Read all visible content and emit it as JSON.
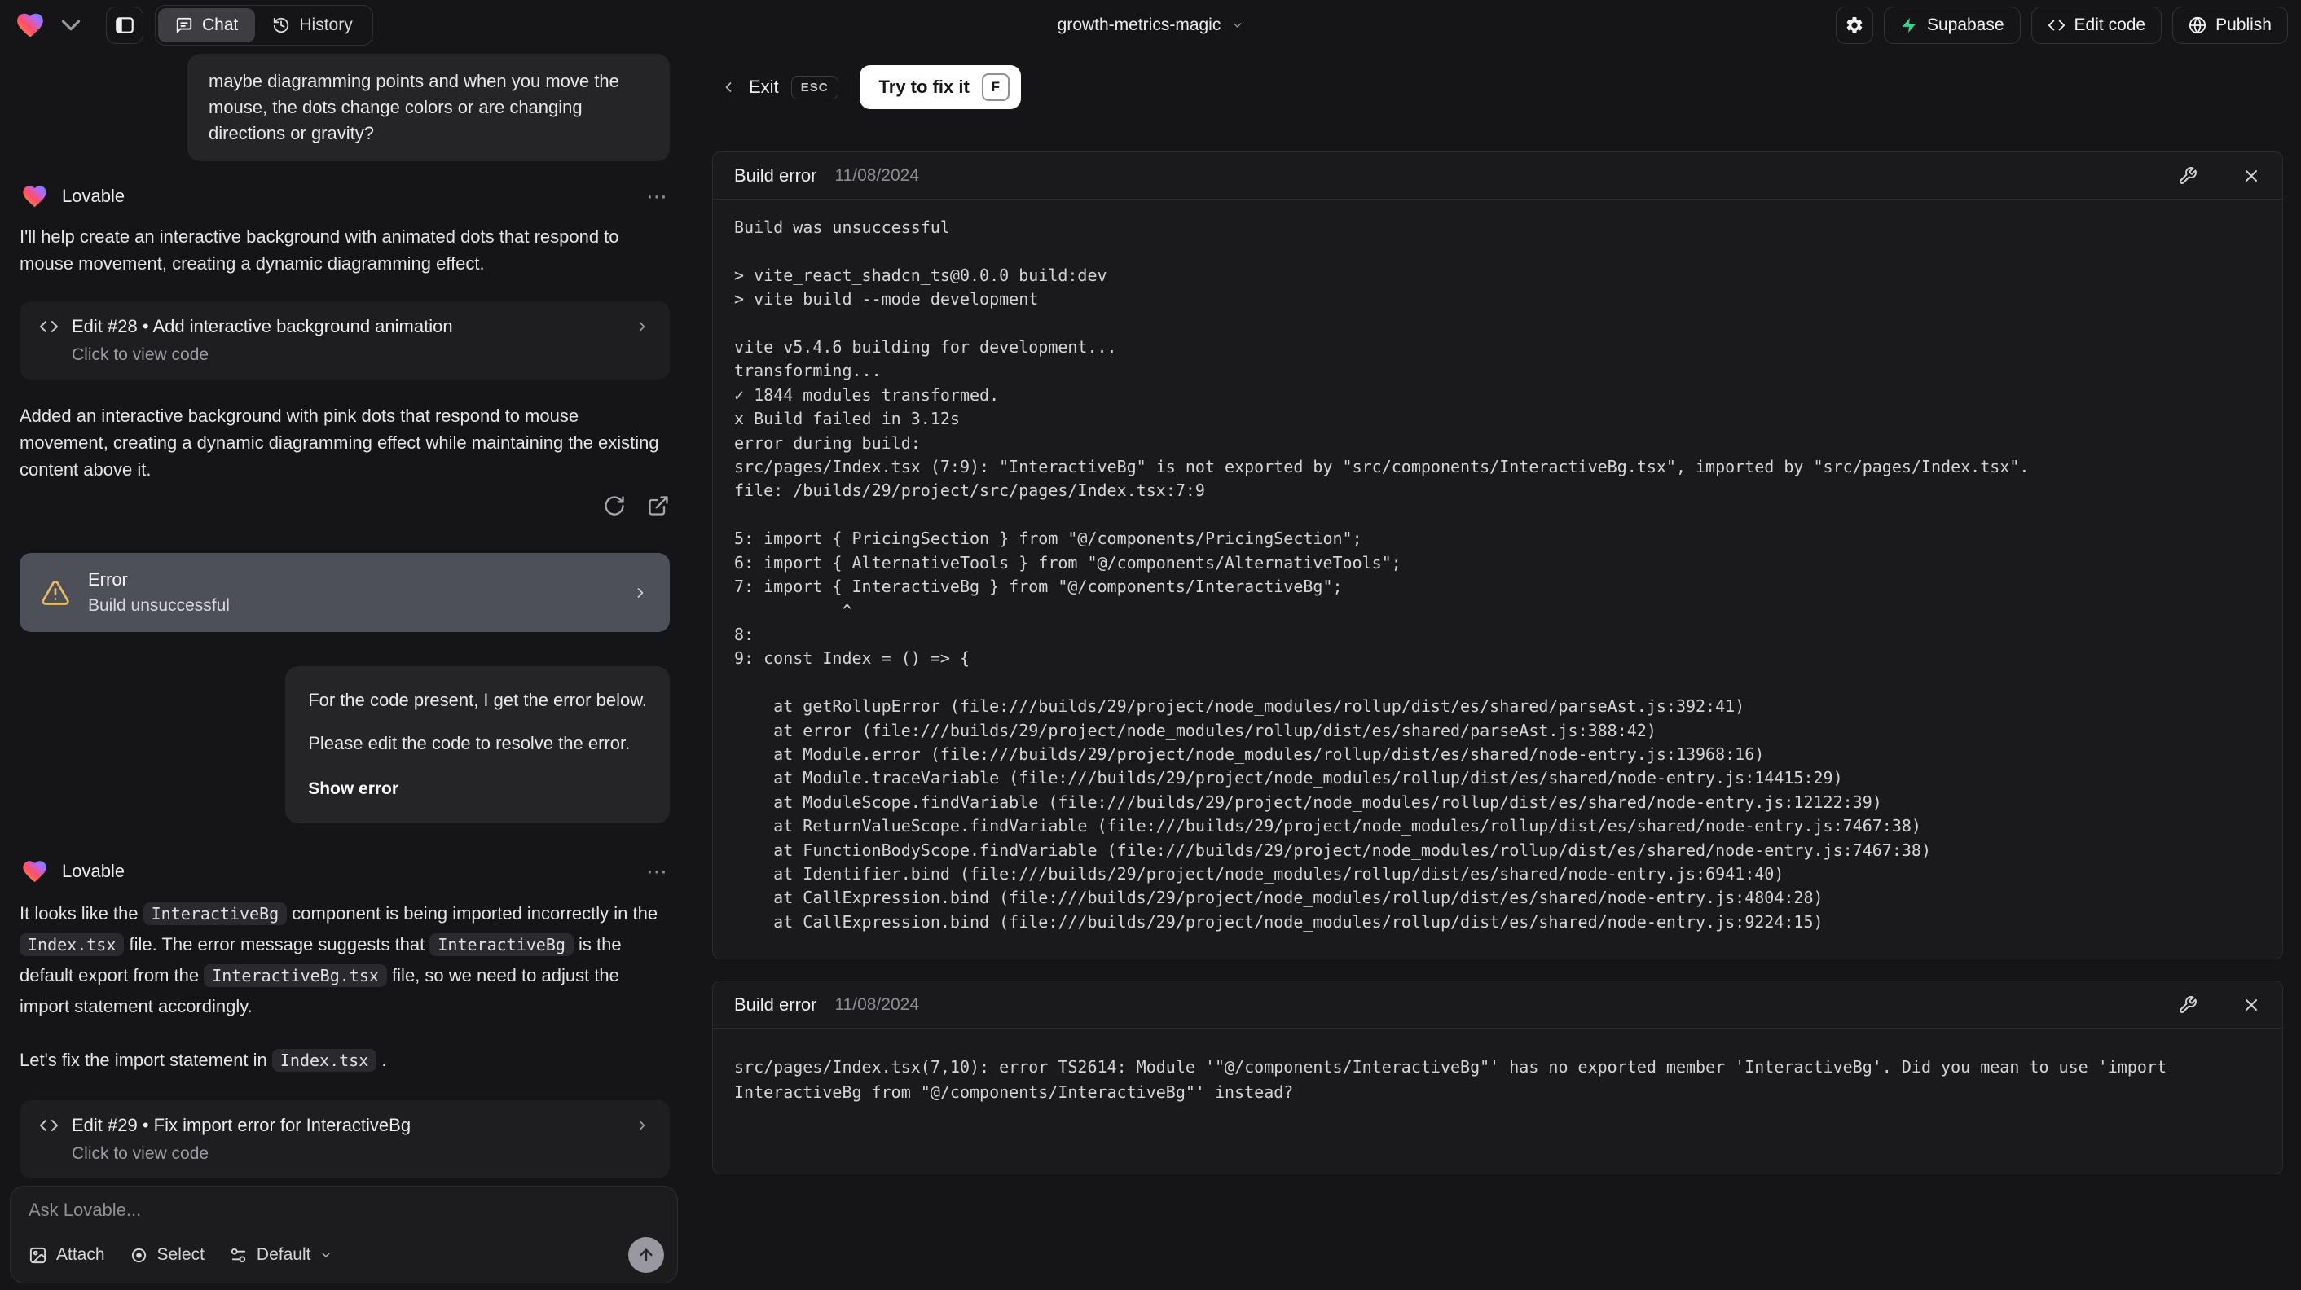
{
  "topbar": {
    "tabs": {
      "chat": "Chat",
      "history": "History"
    },
    "project": "growth-metrics-magic",
    "supabase": "Supabase",
    "edit_code": "Edit code",
    "publish": "Publish"
  },
  "chat": {
    "assistant_name": "Lovable",
    "menu_glyph": "⋯",
    "user_msg1": "maybe diagramming points and when you move the mouse, the dots change colors or are changing directions or gravity?",
    "reply1_intro": "I'll help create an interactive background with animated dots that respond to mouse movement, creating a dynamic diagramming effect.",
    "edit28_title": "Edit #28 • Add interactive background animation",
    "edit28_sub": "Click to view code",
    "reply1_result": "Added an interactive background with pink dots that respond to mouse movement, creating a dynamic diagramming effect while maintaining the existing content above it.",
    "error_title": "Error",
    "error_sub": "Build unsuccessful",
    "user_msg2_l1": "For the code present, I get the error below.",
    "user_msg2_l2": "Please edit the code to resolve the error.",
    "user_msg2_action": "Show error",
    "reply2_p1": [
      {
        "t": "It looks like the "
      },
      {
        "c": "InteractiveBg"
      },
      {
        "t": " component is being imported incorrectly in the "
      },
      {
        "c": "Index.tsx"
      },
      {
        "t": " file. The error message suggests that "
      },
      {
        "c": "InteractiveBg"
      },
      {
        "t": " is the default export from the "
      },
      {
        "c": "InteractiveBg.tsx"
      },
      {
        "t": " file, so we need to adjust the import statement accordingly."
      }
    ],
    "reply2_p2": [
      {
        "t": "Let's fix the import statement in "
      },
      {
        "c": "Index.tsx"
      },
      {
        "t": " ."
      }
    ],
    "edit29_title": "Edit #29 • Fix import error for InteractiveBg",
    "edit29_sub": "Click to view code",
    "composer": {
      "placeholder": "Ask Lovable...",
      "attach": "Attach",
      "select": "Select",
      "model": "Default"
    }
  },
  "error_view": {
    "exit": "Exit",
    "esc": "ESC",
    "fix_label": "Try to fix it",
    "fix_key": "F",
    "card1": {
      "title": "Build error",
      "date": "11/08/2024",
      "log": [
        "Build was unsuccessful",
        "",
        "> vite_react_shadcn_ts@0.0.0 build:dev",
        "> vite build --mode development",
        "",
        "vite v5.4.6 building for development...",
        "transforming...",
        "✓ 1844 modules transformed.",
        "x Build failed in 3.12s",
        "error during build:",
        "src/pages/Index.tsx (7:9): \"InteractiveBg\" is not exported by \"src/components/InteractiveBg.tsx\", imported by \"src/pages/Index.tsx\".",
        "file: /builds/29/project/src/pages/Index.tsx:7:9",
        "",
        "5: import { PricingSection } from \"@/components/PricingSection\";",
        "6: import { AlternativeTools } from \"@/components/AlternativeTools\";",
        "7: import { InteractiveBg } from \"@/components/InteractiveBg\";",
        "           ^",
        "8:",
        "9: const Index = () => {",
        "",
        "    at getRollupError (file:///builds/29/project/node_modules/rollup/dist/es/shared/parseAst.js:392:41)",
        "    at error (file:///builds/29/project/node_modules/rollup/dist/es/shared/parseAst.js:388:42)",
        "    at Module.error (file:///builds/29/project/node_modules/rollup/dist/es/shared/node-entry.js:13968:16)",
        "    at Module.traceVariable (file:///builds/29/project/node_modules/rollup/dist/es/shared/node-entry.js:14415:29)",
        "    at ModuleScope.findVariable (file:///builds/29/project/node_modules/rollup/dist/es/shared/node-entry.js:12122:39)",
        "    at ReturnValueScope.findVariable (file:///builds/29/project/node_modules/rollup/dist/es/shared/node-entry.js:7467:38)",
        "    at FunctionBodyScope.findVariable (file:///builds/29/project/node_modules/rollup/dist/es/shared/node-entry.js:7467:38)",
        "    at Identifier.bind (file:///builds/29/project/node_modules/rollup/dist/es/shared/node-entry.js:6941:40)",
        "    at CallExpression.bind (file:///builds/29/project/node_modules/rollup/dist/es/shared/node-entry.js:4804:28)",
        "    at CallExpression.bind (file:///builds/29/project/node_modules/rollup/dist/es/shared/node-entry.js:9224:15)"
      ]
    },
    "card2": {
      "title": "Build error",
      "date": "11/08/2024",
      "message": "src/pages/Index.tsx(7,10): error TS2614: Module '\"@/components/InteractiveBg\"' has no exported member 'InteractiveBg'. Did you mean to use 'import InteractiveBg from \"@/components/InteractiveBg\"' instead?"
    }
  },
  "colors": {
    "warning": "#e7bb66",
    "supabase_green": "#3ecf8e",
    "accent_card": "#4d5058"
  }
}
